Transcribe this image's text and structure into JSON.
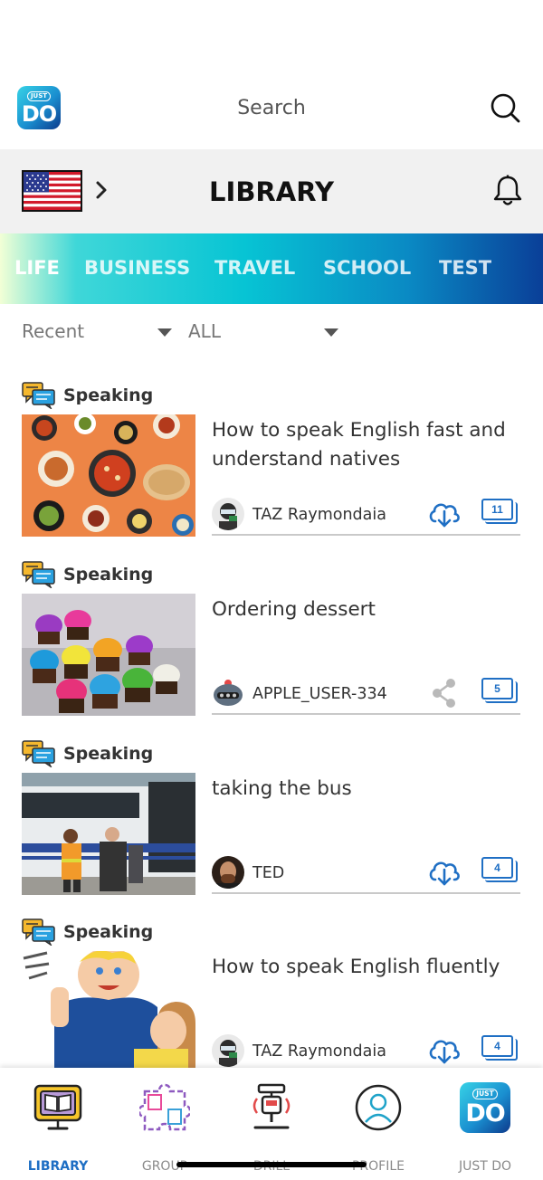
{
  "app": {
    "logo_top": "JUST",
    "logo_bottom": "DO",
    "logo_icon": "just-do-logo"
  },
  "search": {
    "label": "Search",
    "icon": "search-icon"
  },
  "header": {
    "title": "LIBRARY",
    "flag_icon": "us-flag-icon",
    "chevron_icon": "chevron-right-icon",
    "bell_icon": "bell-icon"
  },
  "categories": [
    {
      "label": "LIFE",
      "active": true
    },
    {
      "label": "BUSINESS",
      "active": false
    },
    {
      "label": "TRAVEL",
      "active": false
    },
    {
      "label": "SCHOOL",
      "active": false
    },
    {
      "label": "TEST",
      "active": false
    }
  ],
  "filters": {
    "sort_value": "Recent",
    "scope_value": "ALL"
  },
  "items": [
    {
      "type": "Speaking",
      "title": "How to speak English fast and understand natives",
      "author": "TAZ Raymondaia",
      "action": "download-icon",
      "count": "11",
      "thumb": "food-table-image"
    },
    {
      "type": "Speaking",
      "title": "Ordering dessert",
      "author": "APPLE_USER-334",
      "action": "share-icon",
      "count": "5",
      "thumb": "cupcakes-image"
    },
    {
      "type": "Speaking",
      "title": "taking the bus",
      "author": "TED",
      "action": "download-icon",
      "count": "4",
      "thumb": "bus-image"
    },
    {
      "type": "Speaking",
      "title": "How to speak English fluently",
      "author": "TAZ Raymondaia",
      "action": "download-icon",
      "count": "4",
      "thumb": "cartoon-kids-image"
    }
  ],
  "nav": [
    {
      "label": "LIBRARY",
      "icon": "library-icon",
      "active": true
    },
    {
      "label": "GROUP",
      "icon": "puzzle-icon",
      "active": false
    },
    {
      "label": "DRILL",
      "icon": "drill-icon",
      "active": false
    },
    {
      "label": "PROFILE",
      "icon": "profile-icon",
      "active": false
    },
    {
      "label": "JUST DO",
      "icon": "just-do-logo",
      "active": false
    }
  ],
  "colors": {
    "accent": "#1f6fc4",
    "header_bg": "#f1f1f1",
    "divider": "#c9c9c9"
  }
}
